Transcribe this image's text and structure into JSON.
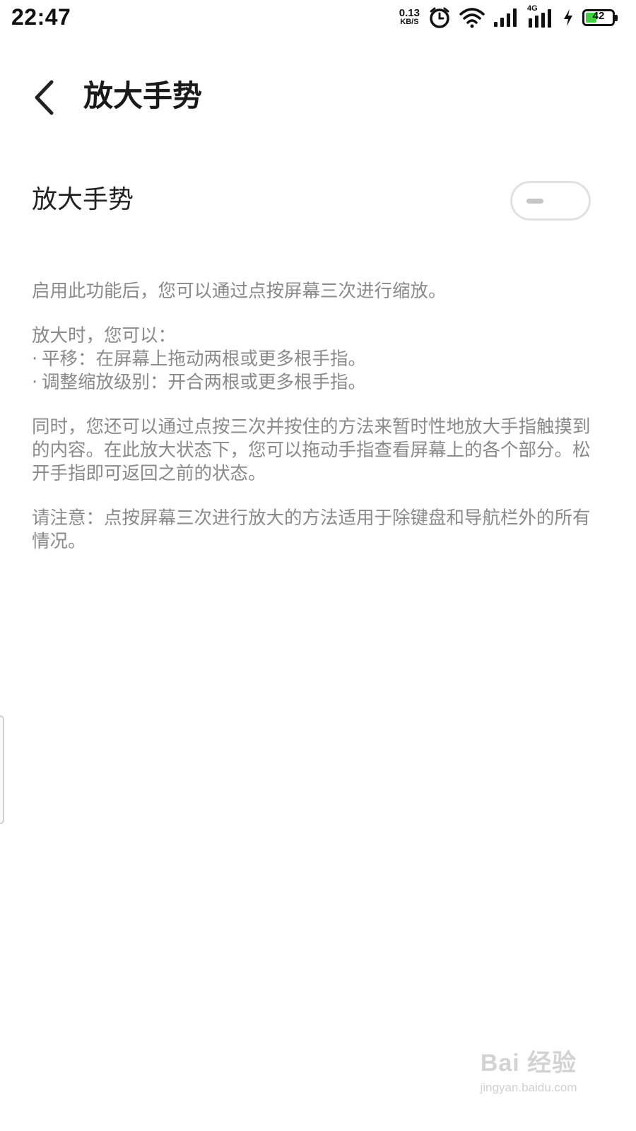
{
  "status_bar": {
    "time": "22:47",
    "net_speed_value": "0.13",
    "net_speed_unit": "KB/S",
    "network_type": "4G",
    "battery_level": "42",
    "battery_fraction": 0.42,
    "icons": [
      "alarm-icon",
      "wifi-icon",
      "signal-icon",
      "signal-4g-icon",
      "charging-icon",
      "battery-icon"
    ]
  },
  "header": {
    "back_icon": "chevron-left-icon",
    "title": "放大手势"
  },
  "setting": {
    "label": "放大手势",
    "enabled": false
  },
  "description": {
    "intro": "启用此功能后，您可以通过点按屏幕三次进行缩放。",
    "when_zoomed": "放大时，您可以：",
    "bullets": [
      "平移：在屏幕上拖动两根或更多根手指。",
      "调整缩放级别：开合两根或更多根手指。"
    ],
    "temporary": "同时，您还可以通过点按三次并按住的方法来暂时性地放大手指触摸到的内容。在此放大状态下，您可以拖动手指查看屏幕上的各个部分。松开手指即可返回之前的状态。",
    "note": "请注意：点按屏幕三次进行放大的方法适用于除键盘和导航栏外的所有情况。"
  },
  "watermark": {
    "logo_text": "Bai 经验",
    "url": "jingyan.baidu.com"
  }
}
